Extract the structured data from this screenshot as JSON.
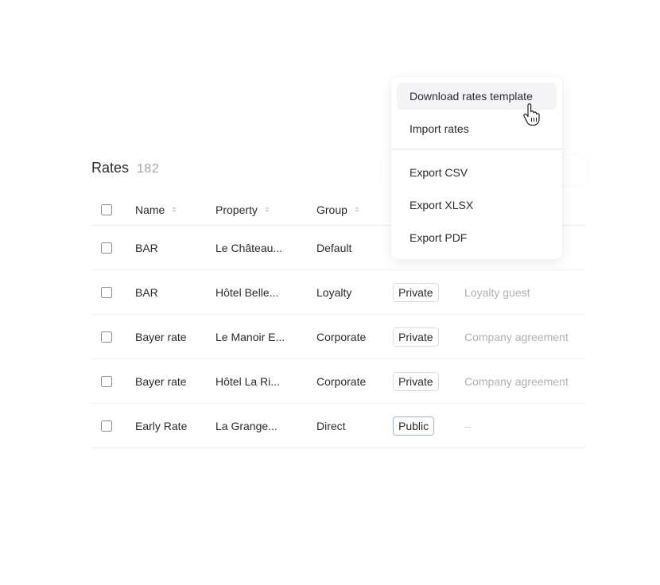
{
  "header": {
    "title": "Rates",
    "count": "182"
  },
  "table": {
    "columns": [
      {
        "label": "Name",
        "sortable": true
      },
      {
        "label": "Property",
        "sortable": true
      },
      {
        "label": "Group",
        "sortable": true
      }
    ],
    "rows": [
      {
        "name": "BAR",
        "property": "Le Château...",
        "group": "Default",
        "visibility": "",
        "description": ""
      },
      {
        "name": "BAR",
        "property": "Hôtel Belle...",
        "group": "Loyalty",
        "visibility": "Private",
        "description": "Loyalty guest"
      },
      {
        "name": "Bayer rate",
        "property": "Le Manoir E...",
        "group": "Corporate",
        "visibility": "Private",
        "description": "Company agreement"
      },
      {
        "name": "Bayer rate",
        "property": "Hôtel La Ri...",
        "group": "Corporate",
        "visibility": "Private",
        "description": "Company agreement"
      },
      {
        "name": "Early Rate",
        "property": "La Grange...",
        "group": "Direct",
        "visibility": "Public",
        "description": "–"
      }
    ]
  },
  "menu": {
    "items": [
      {
        "label": "Download rates template",
        "hovered": true
      },
      {
        "label": "Import rates"
      },
      {
        "label": "Export CSV"
      },
      {
        "label": "Export XLSX"
      },
      {
        "label": "Export PDF"
      }
    ]
  },
  "colors": {
    "public_badge_border": "#9db3d6",
    "text_primary": "#2b2b2e",
    "text_muted": "#b0b0b4"
  }
}
